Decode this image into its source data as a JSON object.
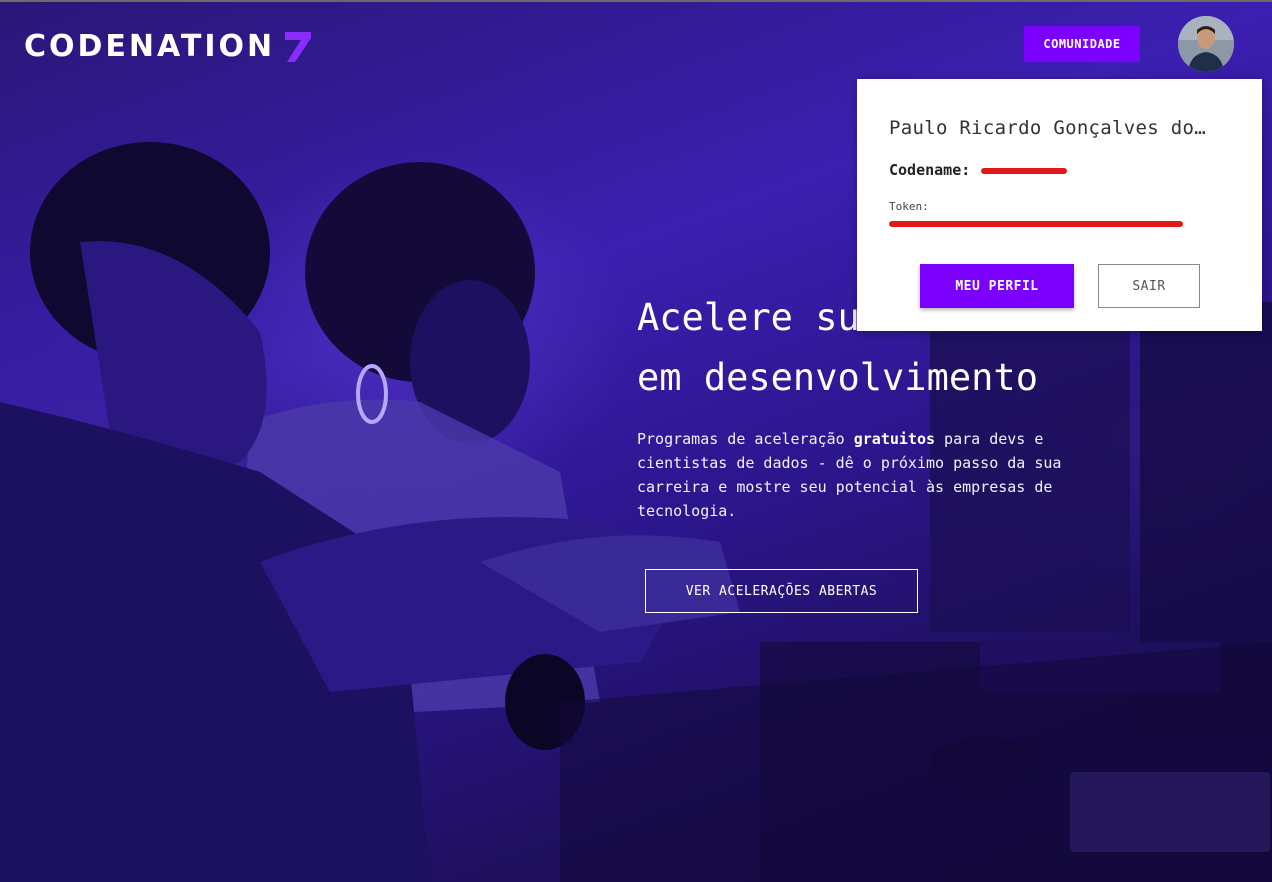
{
  "header": {
    "logo_text": "CODENATION",
    "community_label": "COMUNIDADE",
    "avatar_alt": "user-avatar"
  },
  "user_menu": {
    "full_name": "Paulo Ricardo Gonçalves do…",
    "codename_label": "Codename:",
    "codename_value": "",
    "token_label": "Token:",
    "token_value": "",
    "profile_button": "MEU PERFIL",
    "logout_button": "SAIR"
  },
  "hero": {
    "headline_line1": "Acelere sua",
    "headline_line2": "em desenvolvimento",
    "subtitle_pre": "Programas de aceleração ",
    "subtitle_bold": "gratuitos",
    "subtitle_post": " para devs e cientistas de dados - dê o próximo passo da sua carreira e mostre seu potencial às empresas de tecnologia.",
    "cta_label": "VER ACELERAÇÕES ABERTAS"
  },
  "colors": {
    "accent": "#7b00ff",
    "redaction": "#e01818",
    "hero_overlay": "#3b1fb0"
  }
}
